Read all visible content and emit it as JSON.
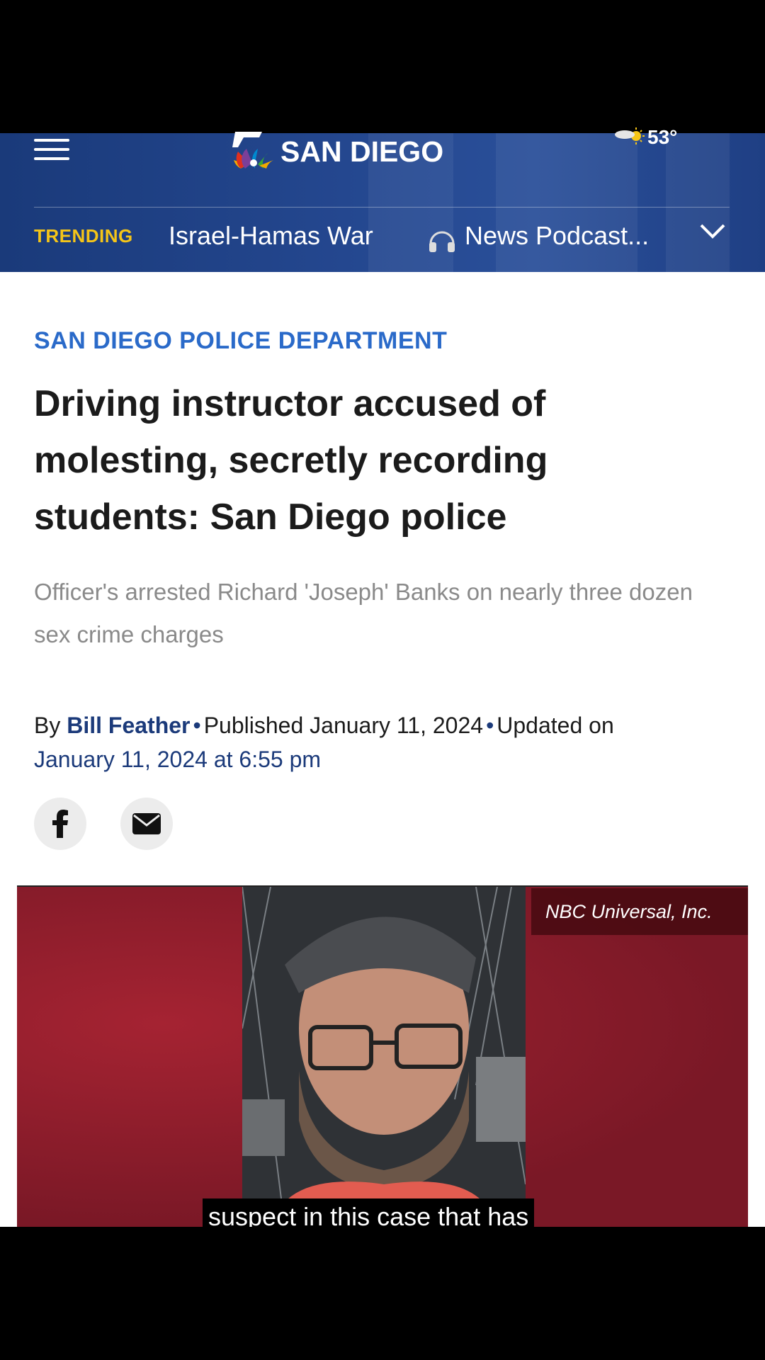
{
  "header": {
    "logo_text": "SAN DIEGO",
    "weather_temp": "53°",
    "trending_label": "TRENDING",
    "trending_links": [
      "Israel-Hamas War",
      "News Podcast..."
    ]
  },
  "article": {
    "section": "SAN DIEGO POLICE DEPARTMENT",
    "headline": "Driving instructor accused of molesting, secretly recording students: San Diego police",
    "subheadline": "Officer's arrested Richard 'Joseph' Banks on nearly three dozen sex crime charges",
    "byline_prefix": "By",
    "author": "Bill Feather",
    "published": "Published January 11, 2024",
    "updated_prefix": "Updated on",
    "updated_date": "January 11, 2024",
    "updated_time": "at 6:55 pm"
  },
  "video": {
    "credit": "NBC Universal, Inc.",
    "caption": "suspect in this case that has"
  },
  "colors": {
    "header_blue": "#24478f",
    "trending_yellow": "#f5c518",
    "section_blue": "#2a6ac9",
    "author_navy": "#1b3a7a",
    "video_red": "#7e1a26"
  },
  "icons": [
    "hamburger-menu-icon",
    "nbc-peacock-icon",
    "weather-partly-sunny-icon",
    "headphones-icon",
    "chevron-down-icon",
    "facebook-icon",
    "email-icon"
  ]
}
